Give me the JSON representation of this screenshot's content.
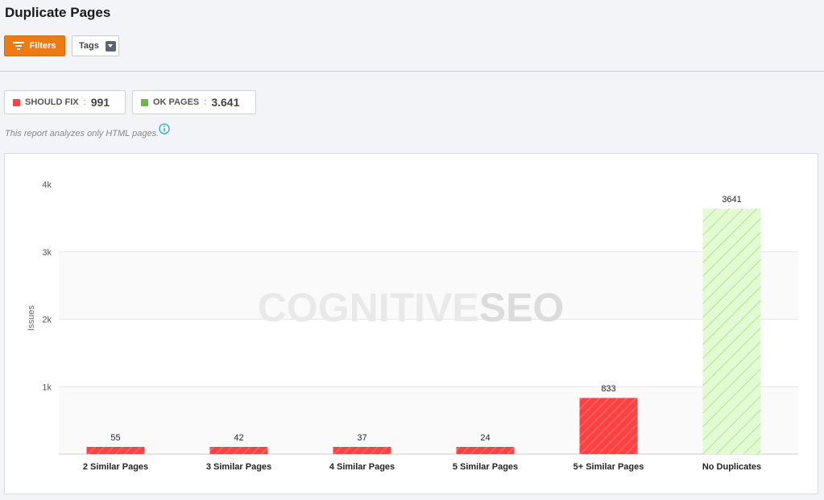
{
  "page": {
    "title": "Duplicate Pages"
  },
  "toolbar": {
    "filters_label": "Filters",
    "tags_label": "Tags"
  },
  "stats": {
    "should_fix": {
      "label": "SHOULD FIX",
      "value": "991",
      "color": "#f04646"
    },
    "ok_pages": {
      "label": "OK PAGES",
      "value": "3.641",
      "color": "#6cbb3c"
    }
  },
  "note": "This report analyzes only HTML pages.",
  "chart": {
    "watermark_light": "COGNITIVE",
    "watermark_bold": "SEO"
  },
  "chart_data": {
    "type": "bar",
    "categories": [
      "2 Similar Pages",
      "3 Similar Pages",
      "4 Similar Pages",
      "5 Similar Pages",
      "5+ Similar Pages",
      "No Duplicates"
    ],
    "values": [
      55,
      42,
      37,
      24,
      833,
      3641
    ],
    "data_labels": [
      "55",
      "42",
      "37",
      "24",
      "833",
      "3641"
    ],
    "bar_status": [
      "fix",
      "fix",
      "fix",
      "fix",
      "fix",
      "ok"
    ],
    "ylabel": "Issues",
    "yticks": [
      1000,
      2000,
      3000,
      4000
    ],
    "ytick_labels": [
      "1k",
      "2k",
      "3k",
      "4k"
    ],
    "ylim": [
      0,
      4000
    ],
    "grid": true,
    "colors": {
      "fix": "#ff4141",
      "ok": "#e3fbd3",
      "ok_stripe": "#9fdc72"
    }
  }
}
